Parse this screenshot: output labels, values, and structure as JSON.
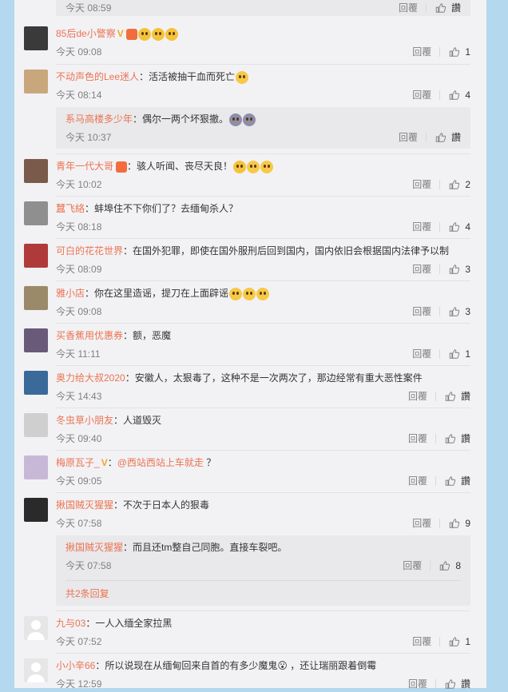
{
  "reply_label": "回覆",
  "comments": [
    {
      "id": "c0",
      "time": "今天 08:59",
      "likes": "讚",
      "partial": true
    },
    {
      "id": "c1",
      "user": "85后de小警察",
      "text": "",
      "time": "今天 09:08",
      "likes": "1",
      "avatar_color": "#3a3a3a",
      "badges": [
        "v",
        "medal"
      ],
      "emojis": [
        "shock",
        "shock",
        "shock"
      ]
    },
    {
      "id": "c2",
      "user": "不动声色的Lee迷人",
      "text": "：活活被抽干血而死亡",
      "time": "今天 08:14",
      "likes": "4",
      "avatar_color": "#c9a77d",
      "emojis": [
        "laugh"
      ]
    },
    {
      "id": "c3",
      "user": "青年一代大哥",
      "text": "：骇人听闻、丧尽天良！",
      "time": "今天 10:02",
      "likes": "2",
      "avatar_color": "#7a5a4a",
      "badges": [
        "medal"
      ],
      "emojis": [
        "shock",
        "laugh",
        "laugh"
      ]
    },
    {
      "id": "c4",
      "user": "蠶飞絡",
      "text": "：蚌埠住不下你们了？去缅甸杀人？",
      "time": "今天 08:18",
      "likes": "4",
      "avatar_color": "#8f8f8f"
    },
    {
      "id": "c5",
      "user": "可白的花花世界",
      "text": "：在国外犯罪，即使在国外服刑后回到国内，国内依旧会根据国内法律予以制",
      "time": "今天 08:09",
      "likes": "3",
      "avatar_color": "#b03a3a"
    },
    {
      "id": "c6",
      "user": "雅小店",
      "text": "：你在这里造谣，提刀在上面辟谣",
      "time": "今天 09:08",
      "likes": "3",
      "avatar_color": "#9a8a6a",
      "emojis": [
        "laugh",
        "laugh",
        "laugh"
      ]
    },
    {
      "id": "c7",
      "user": "买香蕉用优惠券",
      "text": "：额，恶魔",
      "time": "今天 11:11",
      "likes": "1",
      "avatar_color": "#6a5a7a"
    },
    {
      "id": "c8",
      "user": "奥力给大叔2020",
      "text": "：安徽人，太狠毒了，这种不是一次两次了，那边经常有重大恶性案件",
      "time": "今天 14:43",
      "likes": "讚",
      "avatar_color": "#3a6a9a"
    },
    {
      "id": "c9",
      "user": "冬虫草小朋友",
      "text": "：人道毁灭",
      "time": "今天 09:40",
      "likes": "讚",
      "avatar_color": "#cfcfcf"
    },
    {
      "id": "c10",
      "user": "梅原瓦子_",
      "text": " ？",
      "mention": "@西站西站上车就走",
      "time": "今天 09:05",
      "likes": "讚",
      "avatar_color": "#c8b8d8",
      "badges": [
        "v"
      ]
    },
    {
      "id": "c11",
      "user": "揪国贼灭猩猩",
      "text": "：不次于日本人的狠毒",
      "time": "今天 07:58",
      "likes": "9",
      "avatar_color": "#2a2a2a"
    },
    {
      "id": "c12",
      "user": "九与03",
      "text": "：一人入缅全家拉黑",
      "time": "今天 07:52",
      "likes": "1",
      "avatar_color": "#e6e6e6"
    },
    {
      "id": "c13",
      "user": "小小辛66",
      "text": "：所以说现在从缅甸回来自首的有多少魔鬼😮 ，还让瑞丽跟着倒霉",
      "time": "今天 12:59",
      "likes": "讚",
      "avatar_color": "#e6e6e6"
    }
  ],
  "subreplies": [
    {
      "id": "s1",
      "user": "系马高楼多少年",
      "text": "：偶尔一两个坏狠撤。",
      "time": "今天 10:37",
      "likes": "讚",
      "emojis": [
        "scared",
        "scared"
      ]
    },
    {
      "id": "s2",
      "user": "揪国贼灭猩猩",
      "text": "：而且还tm整自己同胞。直接车裂吧。",
      "time": "今天 07:58",
      "likes": "8",
      "more": "共2条回复"
    }
  ]
}
